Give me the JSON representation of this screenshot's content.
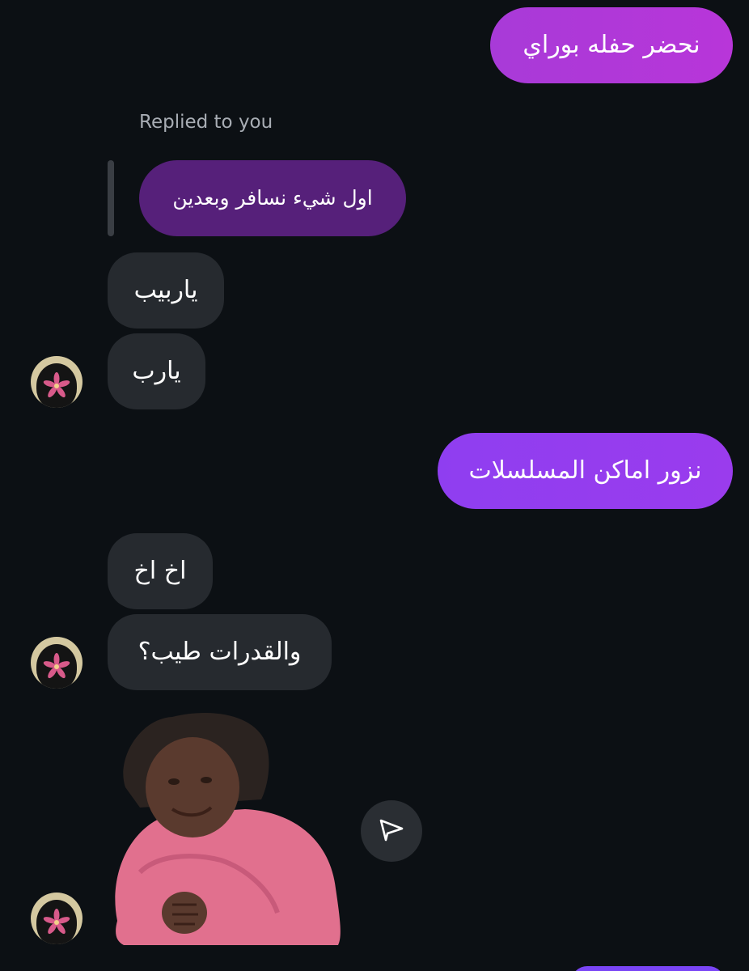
{
  "colors": {
    "background": "#0c1014",
    "received_bubble": "#262a2f",
    "quoted_bubble": "#56207a",
    "sent_bubble_1": "#b236db",
    "sent_bubble_2": "#8e3ef0",
    "sent_bubble_3": "#7a45f5"
  },
  "messages": [
    {
      "id": "m1",
      "direction": "sent",
      "text": "نحضر حفله بوراي"
    },
    {
      "id": "m2",
      "direction": "reply-context",
      "label": "Replied to you",
      "quoted_text": "اول شيء نسافر وبعدين"
    },
    {
      "id": "m3",
      "direction": "received",
      "text": "ياربيب"
    },
    {
      "id": "m4",
      "direction": "received",
      "text": "يارب",
      "avatar_icon": "lily-flower-avatar-icon"
    },
    {
      "id": "m5",
      "direction": "sent",
      "text": "نزور اماكن المسلسلات"
    },
    {
      "id": "m6",
      "direction": "received",
      "text": "اخ اخ"
    },
    {
      "id": "m7",
      "direction": "received",
      "text": "والقدرات طيب؟",
      "avatar_icon": "lily-flower-avatar-icon"
    },
    {
      "id": "m8",
      "direction": "received",
      "type": "sticker",
      "sticker_icon": "child-sticker-image",
      "share_icon": "paper-plane-icon",
      "avatar_icon": "lily-flower-avatar-icon"
    }
  ]
}
